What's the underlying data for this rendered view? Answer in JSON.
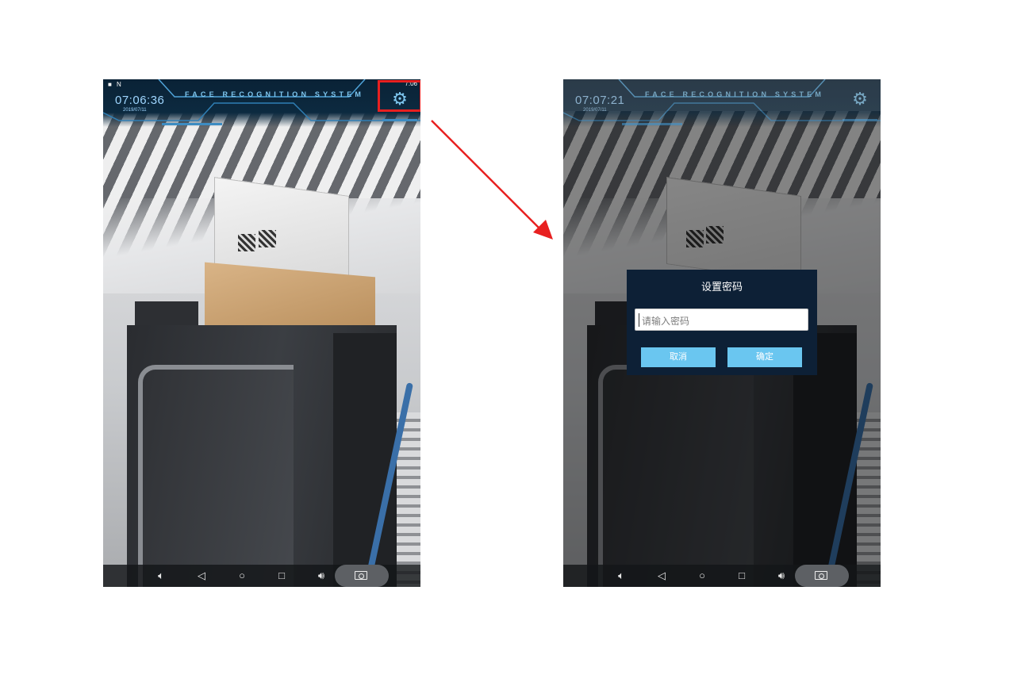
{
  "left_screen": {
    "status_left": "■ N",
    "status_right": "7:06",
    "clock": "07:06:36",
    "date": "2019/07/11",
    "title": "FACE RECOGNITION SYSTEM"
  },
  "right_screen": {
    "clock": "07:07:21",
    "date": "2019/07/11",
    "title": "FACE RECOGNITION SYSTEM",
    "dialog": {
      "title": "设置密码",
      "input_placeholder": "请输入密码",
      "cancel_label": "取消",
      "confirm_label": "确定"
    }
  },
  "navbar": {
    "icons": [
      "volume-down-icon",
      "back-icon",
      "home-icon",
      "recents-icon",
      "volume-up-icon",
      "screenshot-icon"
    ]
  },
  "colors": {
    "highlight": "#e82020",
    "arrow": "#e82020",
    "hud_text": "#7fc7f0",
    "dialog_bg": "#0d2036",
    "dialog_button": "#6ac6f0"
  }
}
